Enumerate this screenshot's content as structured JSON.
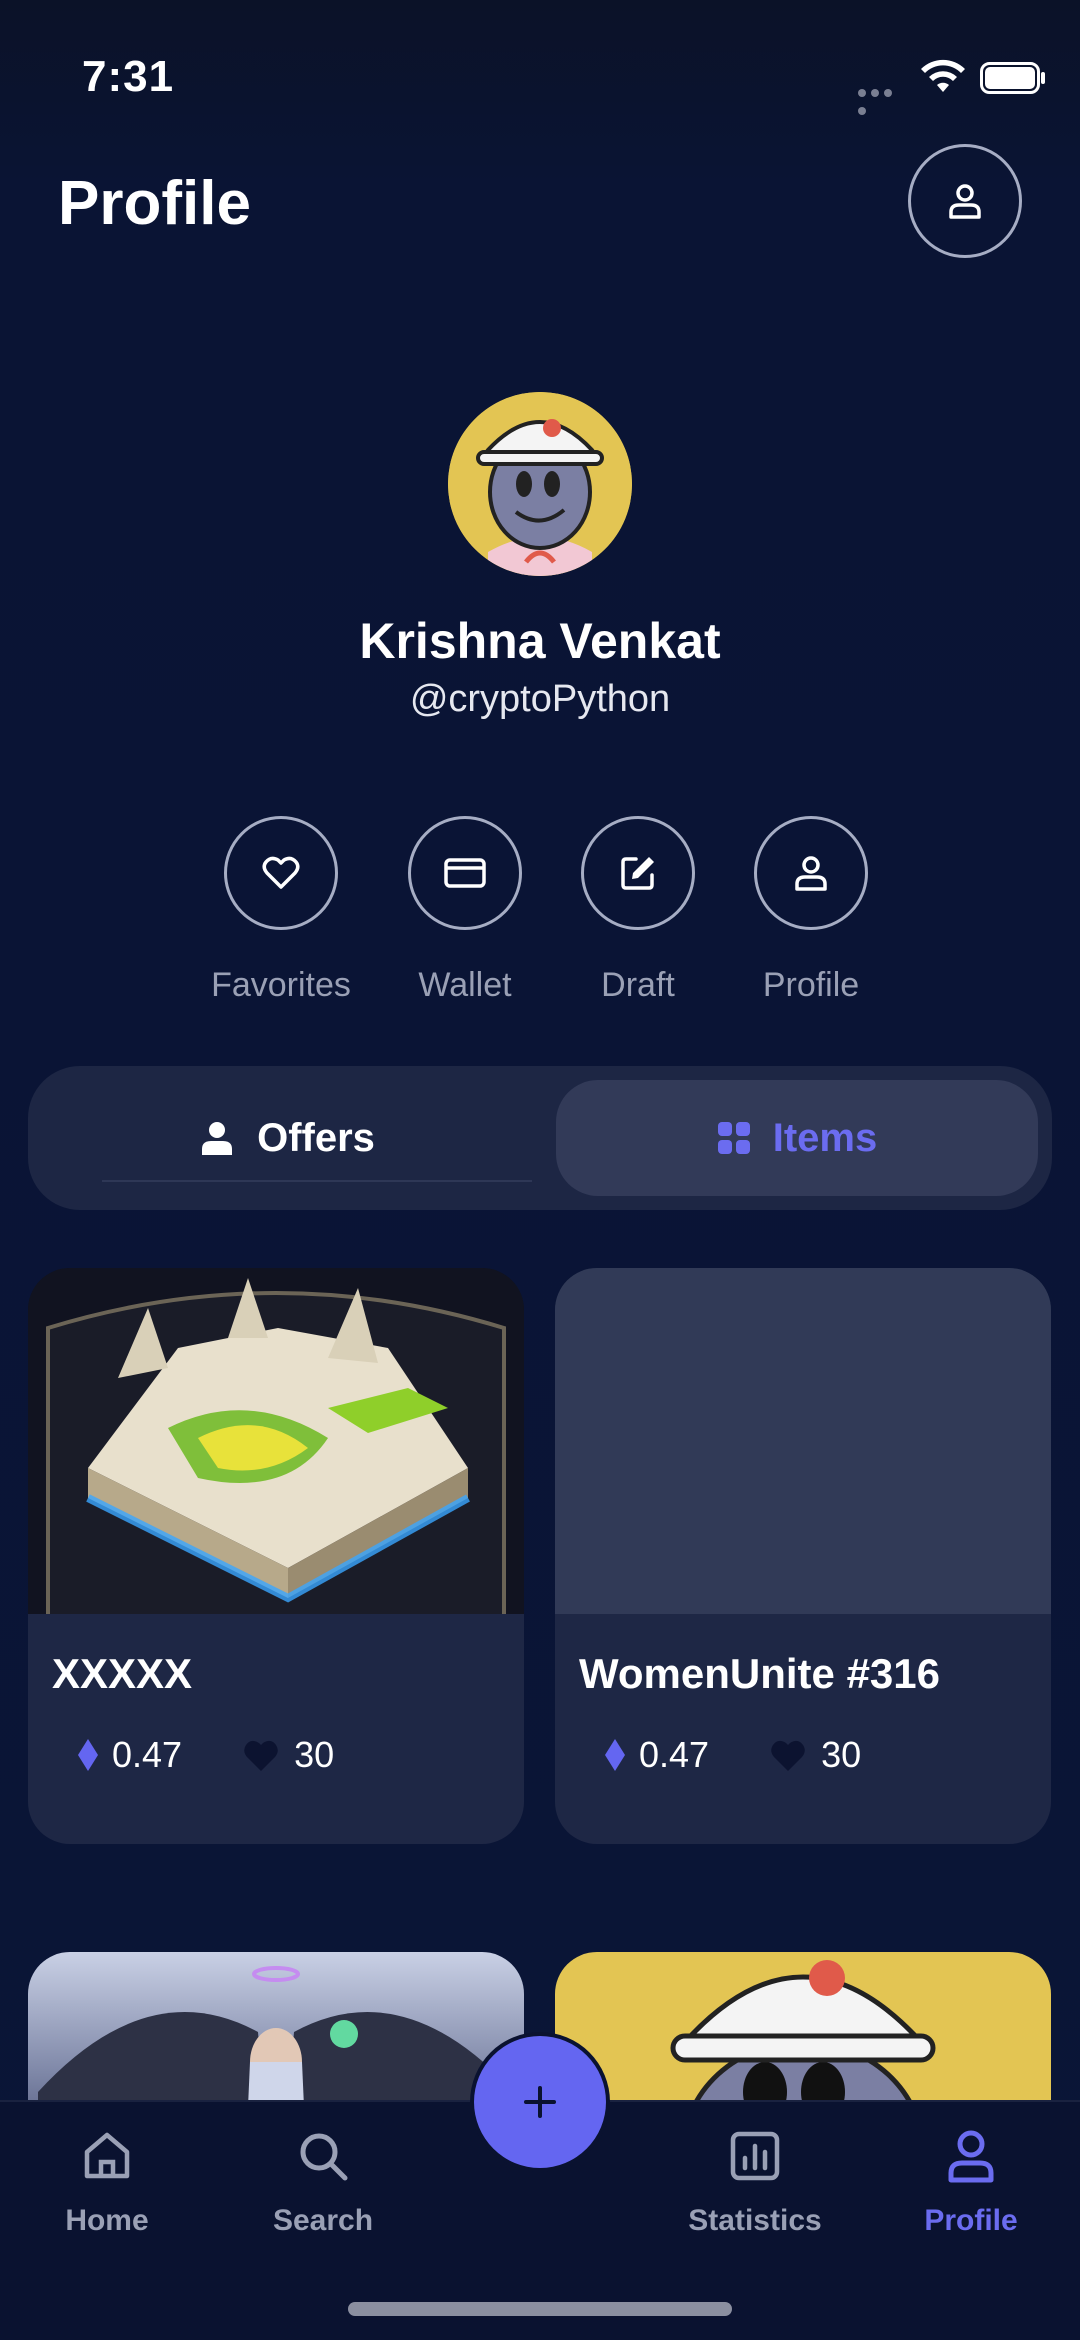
{
  "status_bar": {
    "time": "7:31"
  },
  "header": {
    "title": "Profile"
  },
  "profile": {
    "name": "Krishna Venkat",
    "handle": "@cryptoPython"
  },
  "actions": [
    {
      "label": "Favorites",
      "icon": "heart-icon"
    },
    {
      "label": "Wallet",
      "icon": "wallet-icon"
    },
    {
      "label": "Draft",
      "icon": "edit-icon"
    },
    {
      "label": "Profile",
      "icon": "user-icon"
    }
  ],
  "tabs": [
    {
      "label": "Offers",
      "icon": "user-icon",
      "active": false
    },
    {
      "label": "Items",
      "icon": "grid-icon",
      "active": true
    }
  ],
  "items": [
    {
      "title": "XXXXX",
      "price": "0.47",
      "likes": "30"
    },
    {
      "title": "WomenUnite #316",
      "price": "0.47",
      "likes": "30"
    }
  ],
  "nav": [
    {
      "label": "Home",
      "icon": "home-icon"
    },
    {
      "label": "Search",
      "icon": "search-icon"
    },
    {
      "label": "Statistics",
      "icon": "bar-chart-icon"
    },
    {
      "label": "Profile",
      "icon": "user-icon",
      "active": true
    }
  ],
  "fab": {
    "icon": "plus-icon"
  },
  "colors": {
    "accent": "#6466f1",
    "background": "#0a1537",
    "card": "#1e2745"
  }
}
